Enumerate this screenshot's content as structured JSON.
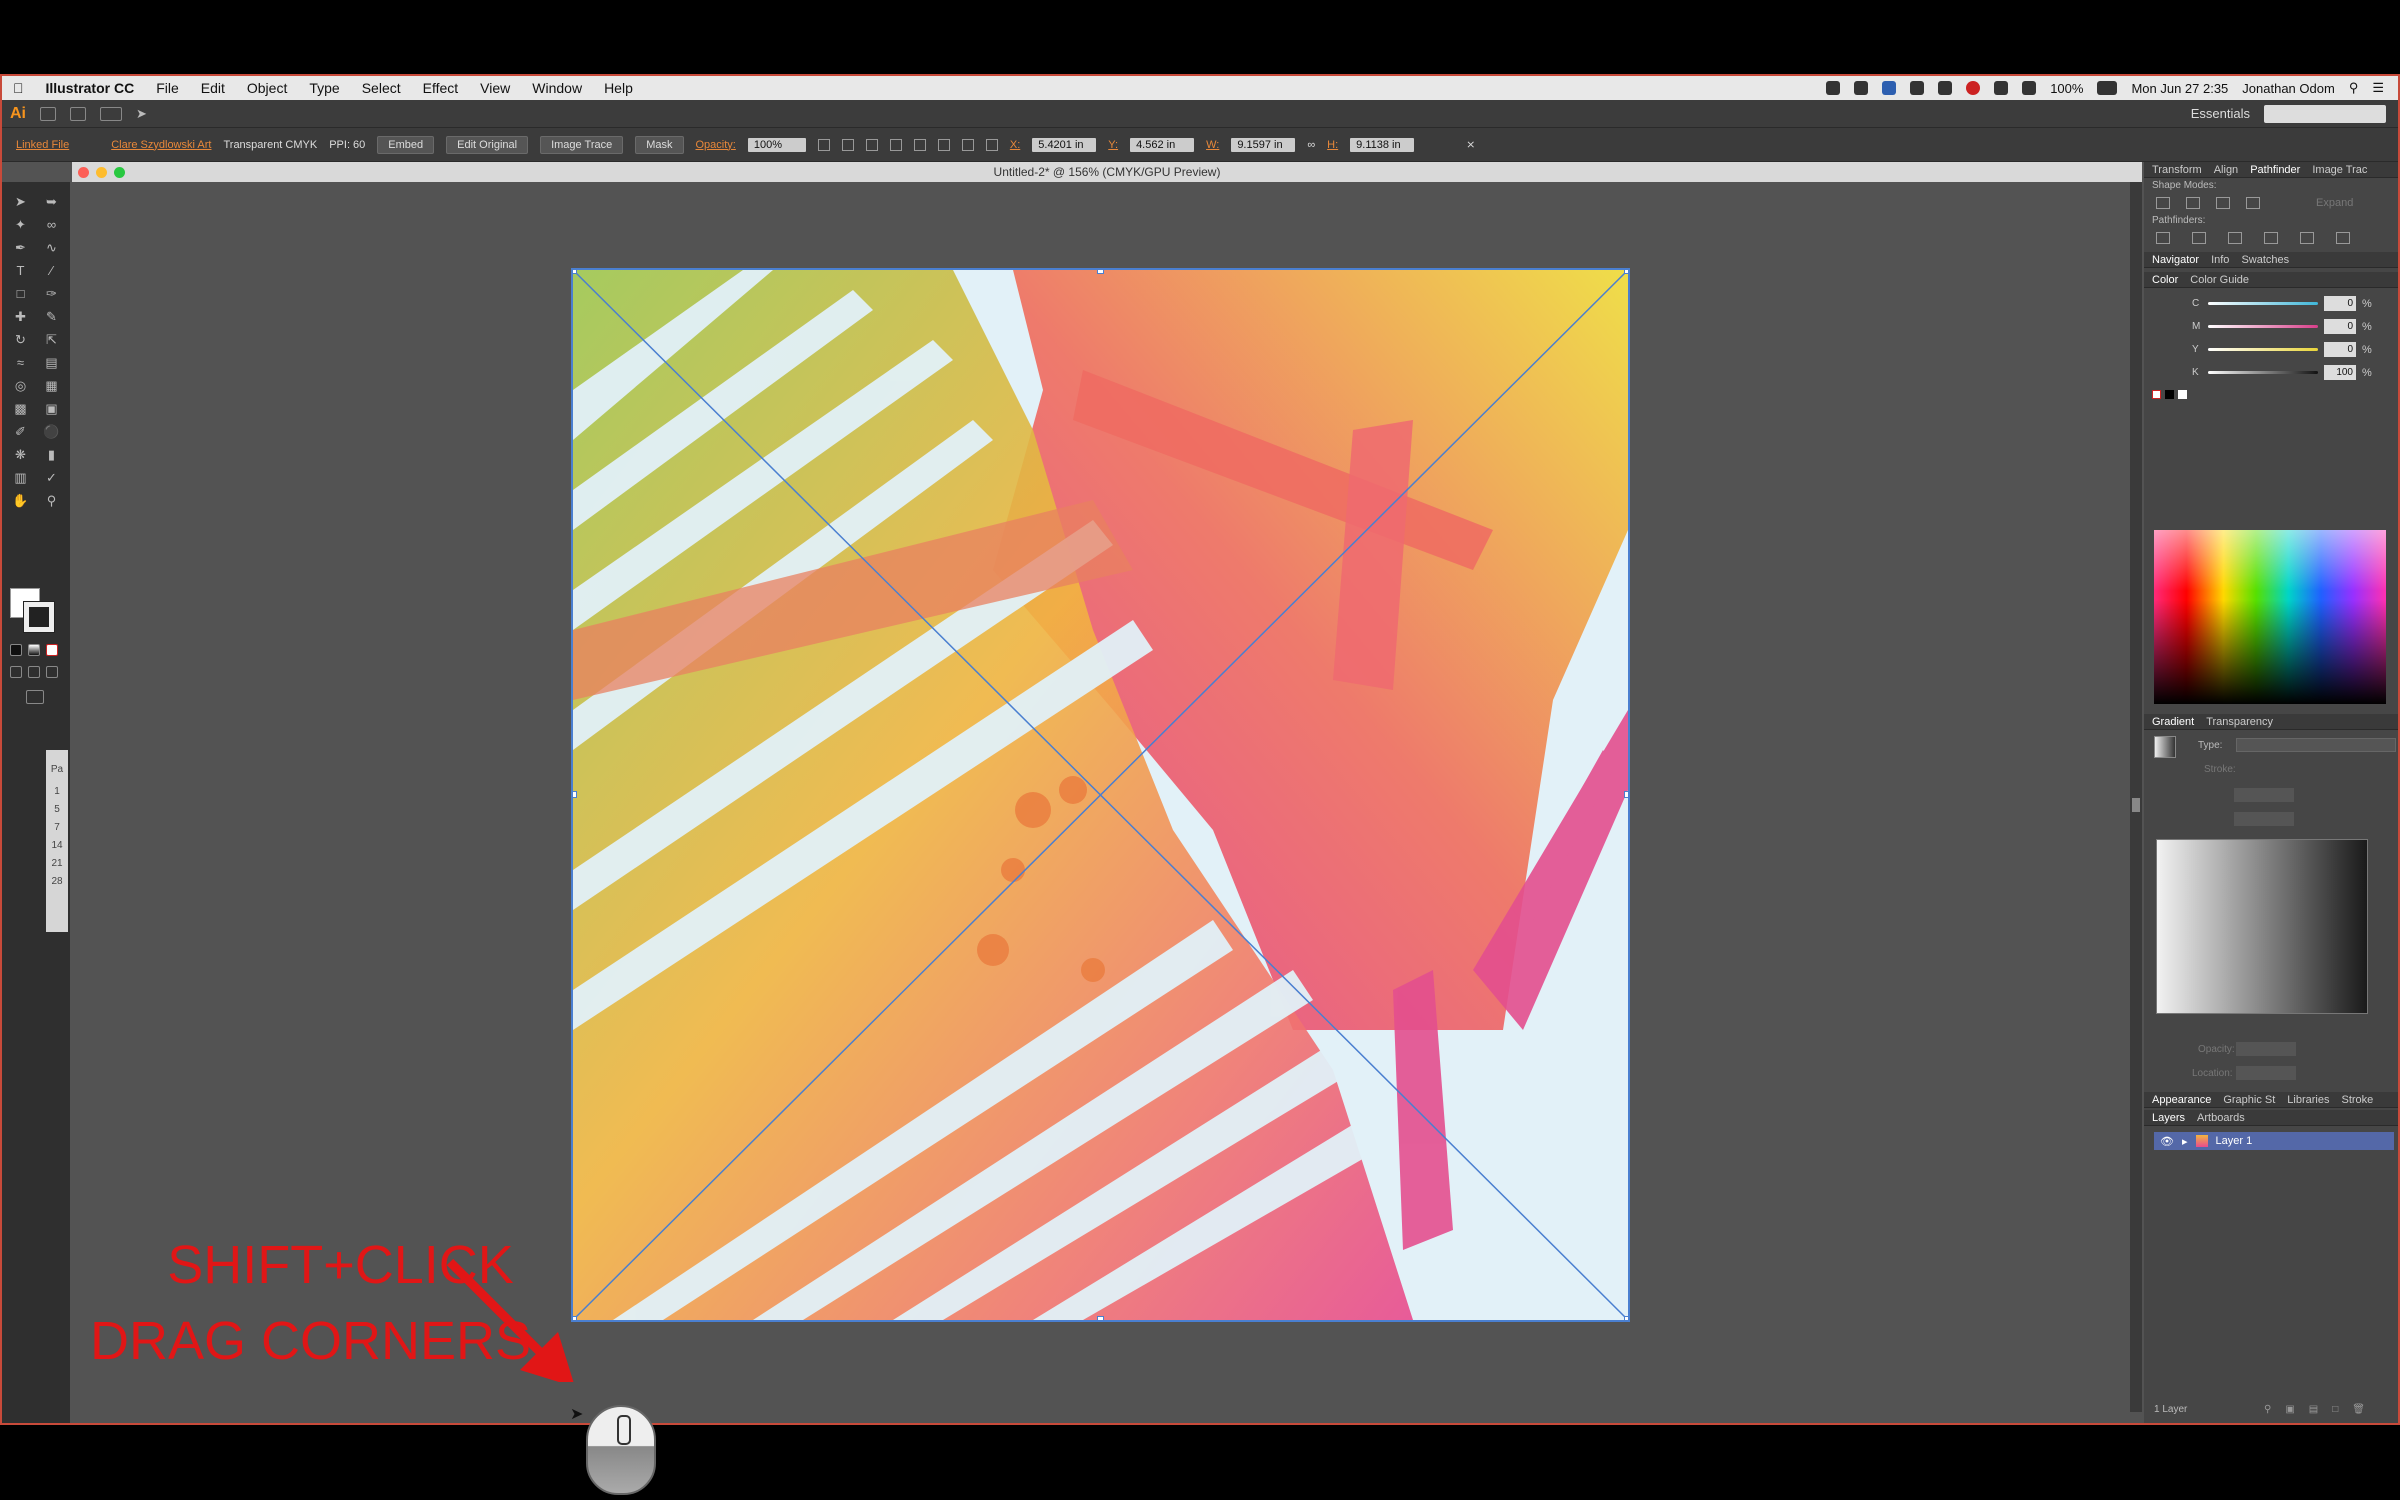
{
  "menu": {
    "apple": "",
    "app_name": "Illustrator CC",
    "items": [
      "File",
      "Edit",
      "Object",
      "Type",
      "Select",
      "Effect",
      "View",
      "Window",
      "Help"
    ],
    "battery": "100%",
    "datetime": "Mon Jun 27 2:35",
    "user": "Jonathan Odom"
  },
  "appbar": {
    "logo": "Ai",
    "workspace": "Essentials"
  },
  "control_bar": {
    "linked_file": "Linked File",
    "file_name": "Clare Szydlowski Art",
    "color_mode": "Transparent CMYK",
    "ppi": "PPI: 60",
    "embed": "Embed",
    "edit_original": "Edit Original",
    "image_trace": "Image Trace",
    "mask": "Mask",
    "opacity_label": "Opacity:",
    "opacity_value": "100%",
    "x_label": "X:",
    "x_value": "5.4201 in",
    "y_label": "Y:",
    "y_value": "4.562 in",
    "w_label": "W:",
    "w_value": "9.1597 in",
    "h_label": "H:",
    "h_value": "9.1138 in"
  },
  "document": {
    "title": "Untitled-2* @ 156% (CMYK/GPU Preview)"
  },
  "tool_strip": {
    "labels": [
      "Pa",
      "1",
      "5",
      "7",
      "14",
      "21",
      "28"
    ]
  },
  "panels": {
    "tabs1": [
      "Transform",
      "Align",
      "Pathfinder",
      "Image Trac"
    ],
    "tabs1_active": 2,
    "shape_modes": "Shape Modes:",
    "expand": "Expand",
    "pathfinders": "Pathfinders:",
    "tabs2": [
      "Navigator",
      "Info",
      "Swatches"
    ],
    "tabs3": [
      "Color",
      "Color Guide"
    ],
    "cmyk": [
      {
        "label": "C",
        "value": "0",
        "color": "#3fb6d8"
      },
      {
        "label": "M",
        "value": "0",
        "color": "#d83f8a"
      },
      {
        "label": "Y",
        "value": "0",
        "color": "#e8d43a"
      },
      {
        "label": "K",
        "value": "100",
        "color": "#111111"
      }
    ],
    "pct": "%",
    "tabs4": [
      "Gradient",
      "Transparency"
    ],
    "type_label": "Type:",
    "stroke_label": "Stroke:",
    "opacity_label": "Opacity:",
    "location_label": "Location:",
    "tabs5": [
      "Appearance",
      "Graphic St",
      "Libraries",
      "Stroke"
    ],
    "tabs6": [
      "Layers",
      "Artboards"
    ],
    "layer_name": "Layer 1",
    "layer_count": "1 Layer"
  },
  "annotation": {
    "line1": "SHIFT+CLICK",
    "line2": "DRAG CORNERS",
    "color": "#e11616"
  }
}
